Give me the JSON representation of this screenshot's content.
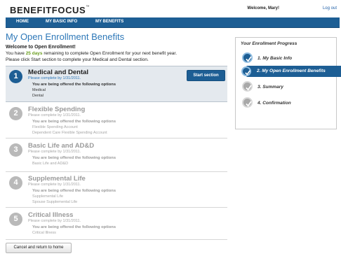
{
  "header": {
    "logo": "BENEFITFOCUS",
    "logo_mark": "™",
    "welcome": "Welcome, Mary!",
    "logout": "Log out"
  },
  "nav": {
    "items": [
      {
        "label": "HOME"
      },
      {
        "label": "MY BASIC INFO"
      },
      {
        "label": "MY BENEFITS"
      }
    ]
  },
  "page": {
    "title": "My Open Enrollment Benefits",
    "welcome_heading": "Welcome to Open Enrollment!",
    "intro_line1_pre": "You have ",
    "intro_days": "25 days",
    "intro_line1_post": " remaining to complete Open Enrollment for your next benefit year.",
    "intro_line2": "Please click Start section to complete your Medical and Dental section."
  },
  "sections": [
    {
      "number": "1",
      "title": "Medical and Dental",
      "due": "Please complete by 1/31/2011.",
      "offer": "You are being offered the following options",
      "options": [
        "Medical",
        "Dental"
      ],
      "button": "Start section"
    },
    {
      "number": "2",
      "title": "Flexible Spending",
      "due": "Please complete by 1/31/2011.",
      "offer": "You are being offered the following options",
      "options": [
        "Flexible Spending Account",
        "Dependent Care Flexible Spending Account"
      ]
    },
    {
      "number": "3",
      "title": "Basic Life and AD&D",
      "due": "Please complete by 1/31/2011.",
      "offer": "You are being offered the following options",
      "options": [
        "Basic Life and AD&D"
      ]
    },
    {
      "number": "4",
      "title": "Supplemental Life",
      "due": "Please complete by 1/31/2011.",
      "offer": "You are being offered the following options",
      "options": [
        "Supplemental Life",
        "Spouse Supplemental Life"
      ]
    },
    {
      "number": "5",
      "title": "Critical Illness",
      "due": "Please complete by 1/31/2011.",
      "offer": "You are being offered the following options",
      "options": [
        "Critical Illness"
      ]
    }
  ],
  "cancel_button": "Cancel and return to home",
  "progress": {
    "title": "Your Enrollment Progress",
    "steps": [
      {
        "label": "1. My Basic Info",
        "state": "done"
      },
      {
        "label": "2. My Open Enrollment Benefits",
        "state": "current"
      },
      {
        "label": "3. Summary",
        "state": "pending"
      },
      {
        "label": "4. Confirmation",
        "state": "pending"
      }
    ]
  },
  "colors": {
    "brand_blue": "#1d5e94",
    "title_blue": "#2e78b8",
    "days_green": "#6a9e1f",
    "inactive_gray": "#b9b9b9"
  }
}
